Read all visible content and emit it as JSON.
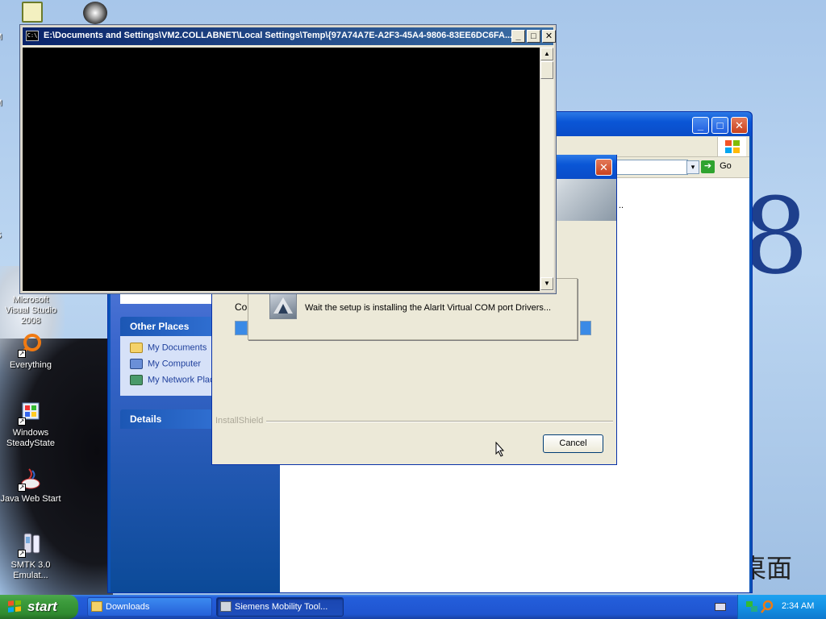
{
  "desktop": {
    "icons": [
      {
        "label": "Microsoft Visual Studio 2008",
        "icon": "visual-studio-icon"
      },
      {
        "label": "Everything",
        "icon": "everything-search-icon"
      },
      {
        "label": "Windows SteadyState",
        "icon": "steadystate-icon"
      },
      {
        "label": "Java Web Start",
        "icon": "java-icon"
      },
      {
        "label": "SMTK 3.0 Emulat...",
        "icon": "emulator-icon"
      }
    ],
    "top_icons": [
      "network-icon",
      "raccoon-icon"
    ],
    "clipped_letters": [
      "M",
      "M",
      "S"
    ],
    "wallpaper_digit": "8",
    "wallpaper_text": "桌面",
    "wallpaper_accent": "#1e3f8c"
  },
  "console_window": {
    "title": "E:\\Documents and Settings\\VM2.COLLABNET\\Local Settings\\Temp\\{97A74A7E-A2F3-45A4-9806-83EE6DC6FA...",
    "icon_text": "C:\\",
    "buttons": {
      "minimize": "_",
      "maximize": "□",
      "close": "✕"
    },
    "scroll_up": "▲",
    "scroll_down": "▼"
  },
  "explorer_window": {
    "buttons": {
      "minimize": "_",
      "maximize": "□",
      "close": "✕"
    },
    "address_dropdown": "▾",
    "go_label": "Go",
    "go_arrow": "➔",
    "right_pane_text": "..",
    "panels": {
      "other_places": {
        "title": "Other Places",
        "items": [
          "My Documents",
          "My Computer",
          "My Network Plac"
        ]
      },
      "details": {
        "title": "Details"
      }
    }
  },
  "setup_dialog": {
    "close": "✕",
    "status_prefix": "Cor",
    "brand_label": "InstallShield",
    "cancel_label": "Cancel"
  },
  "progress_popup": {
    "message": "Wait the setup is installing the AlarIt Virtual COM port Drivers..."
  },
  "taskbar": {
    "start_label": "start",
    "tasks": [
      {
        "label": "Downloads",
        "icon": "folder-icon",
        "active": false
      },
      {
        "label": "Siemens Mobility Tool...",
        "icon": "installer-icon",
        "active": true
      }
    ],
    "clock": "2:34 AM"
  }
}
